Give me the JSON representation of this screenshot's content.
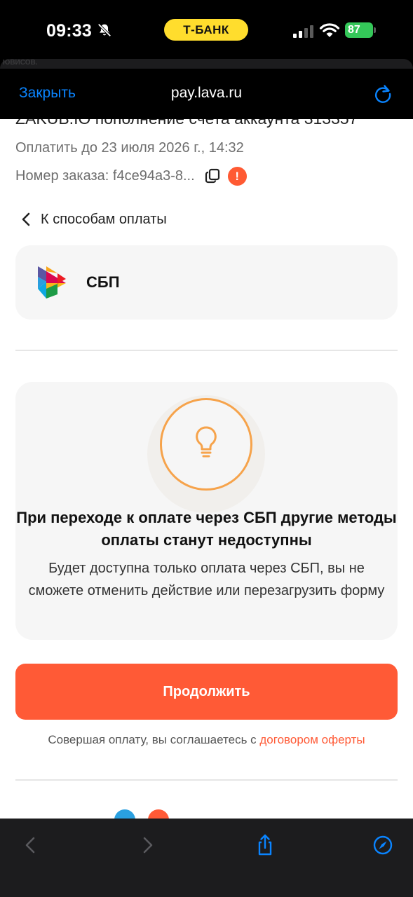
{
  "status_bar": {
    "time": "09:33",
    "carrier_badge": "Т-БАНК",
    "battery": "87"
  },
  "background_sheet": {
    "text": "ЮВИСОВ."
  },
  "browser": {
    "close_label": "Закрыть",
    "url": "pay.lava.ru",
    "accent_color": "#0a84ff"
  },
  "order": {
    "title": "ZAKUB.IO пополнение счета аккаунта 313357",
    "pay_until": "Оплатить до 23 июля 2026 г., 14:32",
    "number": "Номер заказа: f4ce94a3-8..."
  },
  "back_link": {
    "label": "К способам оплаты"
  },
  "payment_method": {
    "name": "СБП"
  },
  "notice": {
    "title": "При переходе к оплате через СБП другие методы оплаты станут недоступны",
    "text": "Будет доступна только оплата через СБП, вы не сможете отменить действие или перезагрузить форму"
  },
  "continue_button": {
    "label": "Продолжить",
    "color": "#ff5a36"
  },
  "agreement": {
    "prefix": "Совершая оплату, вы соглашаетесь с ",
    "link": "договором оферты"
  }
}
